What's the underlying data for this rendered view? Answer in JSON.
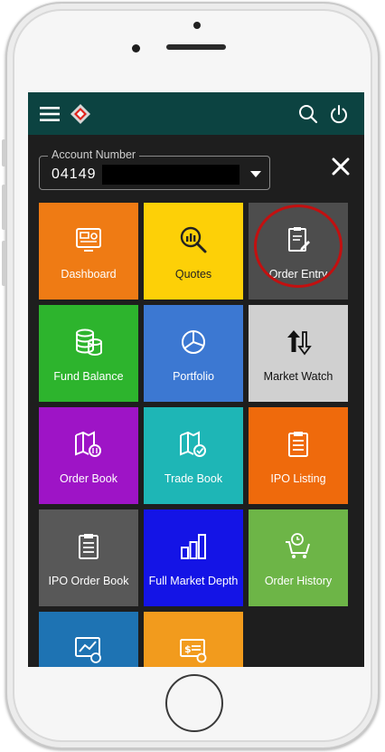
{
  "account": {
    "label": "Account Number",
    "value": "04149"
  },
  "tiles": [
    {
      "label": "Dashboard",
      "color": "#ef7b14",
      "icon": "dashboard-icon"
    },
    {
      "label": "Quotes",
      "color": "#fdd007",
      "icon": "quotes-icon"
    },
    {
      "label": "Order Entry",
      "color": "#4d4d4d",
      "icon": "order-entry-icon"
    },
    {
      "label": "Fund Balance",
      "color": "#2db42d",
      "icon": "coins-icon"
    },
    {
      "label": "Portfolio",
      "color": "#3c78d2",
      "icon": "pie-chart-icon"
    },
    {
      "label": "Market Watch",
      "color": "#d0d0d0",
      "icon": "up-down-arrows-icon"
    },
    {
      "label": "Order Book",
      "color": "#9e14c6",
      "icon": "book-icon"
    },
    {
      "label": "Trade Book",
      "color": "#1eb6b6",
      "icon": "book-check-icon"
    },
    {
      "label": "IPO Listing",
      "color": "#ef6a0c",
      "icon": "clipboard-icon"
    },
    {
      "label": "IPO Order Book",
      "color": "#585858",
      "icon": "clipboard-icon"
    },
    {
      "label": "Full Market Depth",
      "color": "#1414e6",
      "icon": "bars-icon"
    },
    {
      "label": "Order History",
      "color": "#6db547",
      "icon": "cart-clock-icon"
    },
    {
      "label": "",
      "color": "#1e73b3",
      "icon": "chart-clock-icon"
    },
    {
      "label": "",
      "color": "#f29b1d",
      "icon": "payment-icon"
    }
  ]
}
